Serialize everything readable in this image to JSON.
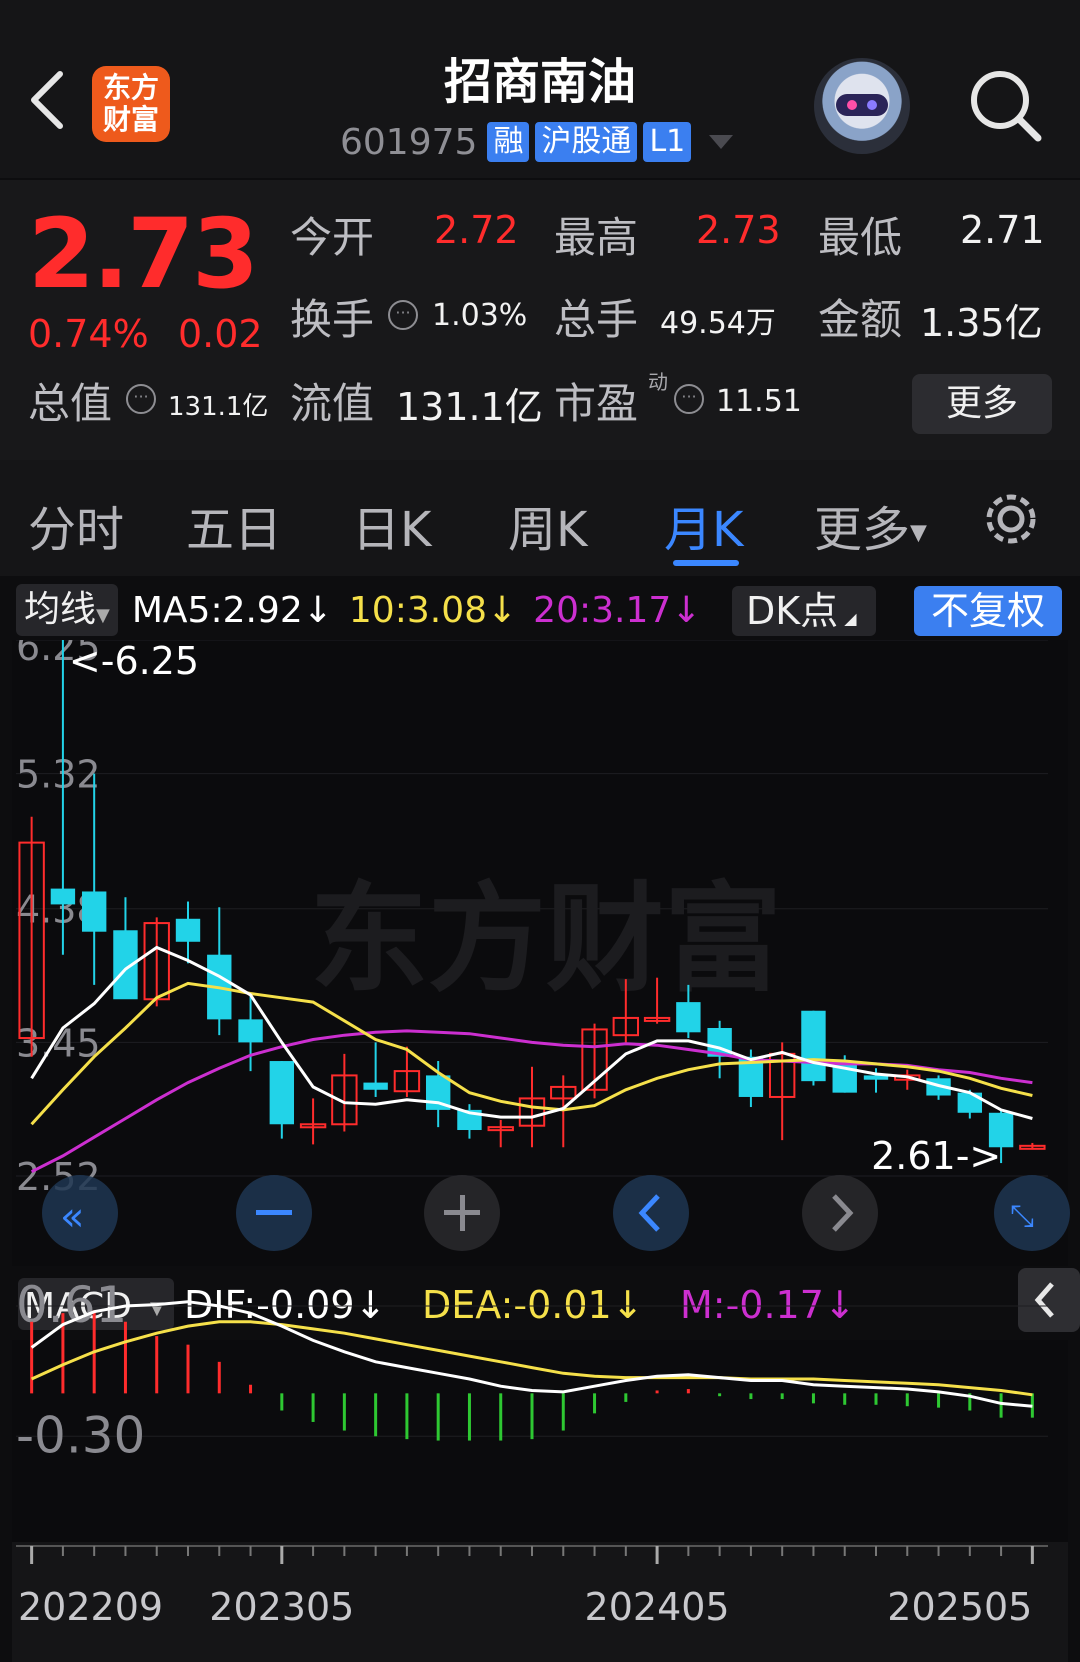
{
  "header": {
    "back_icon": "chevron-left-icon",
    "logo_text": "东方财富",
    "title": "招商南油",
    "code": "601975",
    "tags": [
      "融",
      "沪股通",
      "L1"
    ],
    "search_icon": "search-icon",
    "assistant_icon": "robot-avatar-icon"
  },
  "quote": {
    "price": "2.73",
    "change_pct": "0.74%",
    "change_abs": "0.02",
    "open_label": "今开",
    "open": "2.72",
    "high_label": "最高",
    "high": "2.73",
    "low_label": "最低",
    "low": "2.71",
    "turnover_label": "换手",
    "turnover": "1.03%",
    "volume_label": "总手",
    "volume": "49.54万",
    "amount_label": "金额",
    "amount": "1.35亿",
    "mktcap_label": "总值",
    "mktcap": "131.1亿",
    "float_label": "流值",
    "float": "131.1亿",
    "pe_label": "市盈",
    "pe_sup": "动",
    "pe": "11.51",
    "more_label": "更多"
  },
  "tabs": [
    "分时",
    "五日",
    "日K",
    "周K",
    "月K",
    "更多"
  ],
  "active_tab": "月K",
  "settings_icon": "gear-icon",
  "chart_header": {
    "indicator": "均线",
    "ma5": "MA5:2.92↓",
    "ma10": "10:3.08↓",
    "ma20": "20:3.17↓",
    "dk": "DK点",
    "adjust": "不复权"
  },
  "colors": {
    "up": "#ff2c2c",
    "down": "#22d3e8",
    "ma5": "#ffffff",
    "ma10": "#f5e04a",
    "ma20": "#cc2fd0",
    "accent": "#3b87ff"
  },
  "chart_data": [
    {
      "type": "candlestick",
      "y_ticks": [
        "6.25",
        "5.32",
        "4.38",
        "3.45",
        "2.52"
      ],
      "ylim": [
        2.52,
        6.25
      ],
      "high_marker": "<-6.25",
      "low_marker": "2.61->",
      "x_ticks": [
        "202209",
        "202305",
        "202405",
        "202505"
      ],
      "candles": [
        {
          "o": 3.48,
          "h": 5.02,
          "l": 3.35,
          "c": 4.84
        },
        {
          "o": 4.52,
          "h": 6.25,
          "l": 4.06,
          "c": 4.41
        },
        {
          "o": 4.5,
          "h": 5.32,
          "l": 3.85,
          "c": 4.22
        },
        {
          "o": 4.23,
          "h": 4.46,
          "l": 3.95,
          "c": 3.75
        },
        {
          "o": 3.75,
          "h": 4.32,
          "l": 3.7,
          "c": 4.28
        },
        {
          "o": 4.31,
          "h": 4.43,
          "l": 4.0,
          "c": 4.15
        },
        {
          "o": 4.06,
          "h": 4.39,
          "l": 3.5,
          "c": 3.61
        },
        {
          "o": 3.61,
          "h": 3.78,
          "l": 3.25,
          "c": 3.45
        },
        {
          "o": 3.32,
          "h": 3.32,
          "l": 2.78,
          "c": 2.88
        },
        {
          "o": 2.86,
          "h": 3.06,
          "l": 2.74,
          "c": 2.88
        },
        {
          "o": 2.88,
          "h": 3.37,
          "l": 2.83,
          "c": 3.22
        },
        {
          "o": 3.17,
          "h": 3.45,
          "l": 3.07,
          "c": 3.12
        },
        {
          "o": 3.11,
          "h": 3.42,
          "l": 3.07,
          "c": 3.25
        },
        {
          "o": 3.22,
          "h": 3.32,
          "l": 2.86,
          "c": 2.98
        },
        {
          "o": 2.98,
          "h": 3.02,
          "l": 2.78,
          "c": 2.84
        },
        {
          "o": 2.84,
          "h": 2.91,
          "l": 2.72,
          "c": 2.86
        },
        {
          "o": 2.87,
          "h": 3.28,
          "l": 2.72,
          "c": 3.06
        },
        {
          "o": 3.06,
          "h": 3.22,
          "l": 2.72,
          "c": 3.14
        },
        {
          "o": 3.12,
          "h": 3.58,
          "l": 3.06,
          "c": 3.54
        },
        {
          "o": 3.5,
          "h": 3.89,
          "l": 3.45,
          "c": 3.62
        },
        {
          "o": 3.62,
          "h": 3.9,
          "l": 3.58,
          "c": 3.62
        },
        {
          "o": 3.73,
          "h": 3.85,
          "l": 3.48,
          "c": 3.52
        },
        {
          "o": 3.55,
          "h": 3.6,
          "l": 3.2,
          "c": 3.35
        },
        {
          "o": 3.35,
          "h": 3.4,
          "l": 3.0,
          "c": 3.07
        },
        {
          "o": 3.07,
          "h": 3.45,
          "l": 2.77,
          "c": 3.37
        },
        {
          "o": 3.67,
          "h": 3.67,
          "l": 3.15,
          "c": 3.18
        },
        {
          "o": 3.32,
          "h": 3.36,
          "l": 3.1,
          "c": 3.1
        },
        {
          "o": 3.22,
          "h": 3.27,
          "l": 3.1,
          "c": 3.19
        },
        {
          "o": 3.19,
          "h": 3.26,
          "l": 3.12,
          "c": 3.22
        },
        {
          "o": 3.2,
          "h": 3.22,
          "l": 3.05,
          "c": 3.08
        },
        {
          "o": 3.1,
          "h": 3.12,
          "l": 2.92,
          "c": 2.96
        },
        {
          "o": 2.96,
          "h": 2.98,
          "l": 2.61,
          "c": 2.72
        },
        {
          "o": 2.72,
          "h": 2.75,
          "l": 2.71,
          "c": 2.73
        }
      ],
      "ma5": [
        3.2,
        3.55,
        3.72,
        3.96,
        4.11,
        4.02,
        3.91,
        3.78,
        3.45,
        3.14,
        3.03,
        3.02,
        3.05,
        3.03,
        2.96,
        2.93,
        2.93,
        2.99,
        3.18,
        3.37,
        3.46,
        3.46,
        3.41,
        3.33,
        3.38,
        3.31,
        3.27,
        3.23,
        3.21,
        3.15,
        3.1,
        2.98,
        2.92
      ],
      "ma10": [
        2.88,
        3.12,
        3.35,
        3.55,
        3.76,
        3.86,
        3.83,
        3.79,
        3.76,
        3.73,
        3.6,
        3.47,
        3.4,
        3.24,
        3.1,
        3.04,
        3.0,
        2.98,
        3.01,
        3.12,
        3.2,
        3.26,
        3.3,
        3.31,
        3.32,
        3.33,
        3.32,
        3.3,
        3.28,
        3.25,
        3.2,
        3.13,
        3.08
      ],
      "ma20": [
        2.55,
        2.66,
        2.79,
        2.92,
        3.05,
        3.17,
        3.27,
        3.36,
        3.42,
        3.47,
        3.5,
        3.52,
        3.53,
        3.52,
        3.51,
        3.48,
        3.45,
        3.43,
        3.42,
        3.44,
        3.43,
        3.4,
        3.37,
        3.33,
        3.32,
        3.31,
        3.3,
        3.3,
        3.29,
        3.26,
        3.24,
        3.2,
        3.17
      ]
    },
    {
      "type": "macd",
      "indicator": "MACD",
      "dif_label": "DIF:-0.09↓",
      "dea_label": "DEA:-0.01↓",
      "m_label": "M:-0.17↓",
      "y_ticks": [
        "0.61",
        "-0.30"
      ],
      "ylim": [
        -0.34,
        0.68
      ],
      "dif": [
        0.32,
        0.48,
        0.57,
        0.61,
        0.62,
        0.64,
        0.61,
        0.56,
        0.47,
        0.37,
        0.29,
        0.22,
        0.18,
        0.14,
        0.1,
        0.05,
        0.02,
        0.01,
        0.05,
        0.09,
        0.12,
        0.13,
        0.11,
        0.09,
        0.09,
        0.06,
        0.05,
        0.04,
        0.03,
        0.01,
        -0.02,
        -0.07,
        -0.09
      ],
      "dea": [
        0.1,
        0.2,
        0.29,
        0.36,
        0.42,
        0.47,
        0.5,
        0.5,
        0.48,
        0.45,
        0.42,
        0.38,
        0.34,
        0.3,
        0.26,
        0.22,
        0.18,
        0.14,
        0.12,
        0.11,
        0.11,
        0.11,
        0.11,
        0.1,
        0.1,
        0.1,
        0.09,
        0.08,
        0.07,
        0.06,
        0.04,
        0.02,
        -0.01
      ],
      "macd": [
        0.5,
        0.56,
        0.58,
        0.5,
        0.4,
        0.34,
        0.22,
        0.06,
        -0.12,
        -0.2,
        -0.26,
        -0.3,
        -0.32,
        -0.33,
        -0.33,
        -0.33,
        -0.32,
        -0.26,
        -0.14,
        -0.06,
        0.02,
        0.03,
        -0.02,
        -0.04,
        -0.04,
        -0.07,
        -0.08,
        -0.08,
        -0.09,
        -0.1,
        -0.12,
        -0.17,
        -0.17
      ]
    }
  ]
}
